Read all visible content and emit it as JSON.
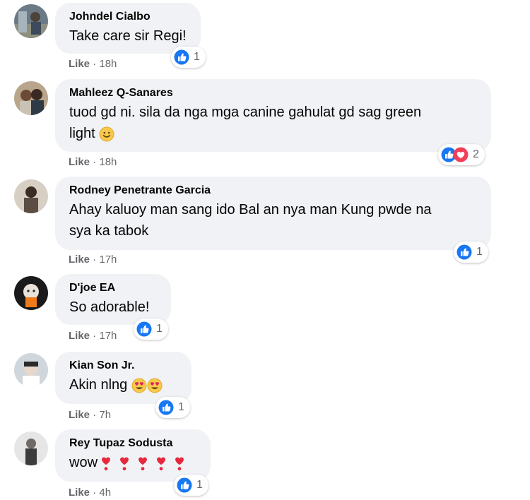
{
  "colors": {
    "bubble_bg": "#f0f2f5",
    "like_blue": "#1877f2",
    "love_red": "#f33e58",
    "meta_gray": "#65676b"
  },
  "comments": [
    {
      "author": "Johndel Cialbo",
      "text": "Take care sir Regi!",
      "like_label": "Like",
      "time": "18h",
      "reaction_count": "1",
      "reactions": [
        "like-icon"
      ]
    },
    {
      "author": "Mahleez Q-Sanares",
      "text_line1": "tuod gd ni. sila da nga mga canine gahulat gd sag green",
      "text_line2": "light",
      "emoji": "slightly-smiling-face-emoji",
      "like_label": "Like",
      "time": "18h",
      "reaction_count": "2",
      "reactions": [
        "like-icon",
        "love-icon"
      ]
    },
    {
      "author": "Rodney Penetrante Garcia",
      "text_line1": "Ahay kaluoy man sang ido Bal an nya man Kung pwde na",
      "text_line2": "sya ka tabok",
      "like_label": "Like",
      "time": "17h",
      "reaction_count": "1",
      "reactions": [
        "like-icon"
      ]
    },
    {
      "author": "D'joe EA",
      "text": "So adorable!",
      "like_label": "Like",
      "time": "17h",
      "reaction_count": "1",
      "reactions": [
        "like-icon"
      ]
    },
    {
      "author": "Kian Son Jr.",
      "text": "Akin nlng",
      "emoji": "heart-eyes-emoji",
      "like_label": "Like",
      "time": "7h",
      "reaction_count": "1",
      "reactions": [
        "like-icon"
      ]
    },
    {
      "author": "Rey Tupaz Sodusta",
      "text": "wow",
      "emoji": "red-heart-exclamation-emoji",
      "like_label": "Like",
      "time": "4h",
      "reaction_count": "1",
      "reactions": [
        "like-icon"
      ]
    }
  ],
  "separator": " · "
}
